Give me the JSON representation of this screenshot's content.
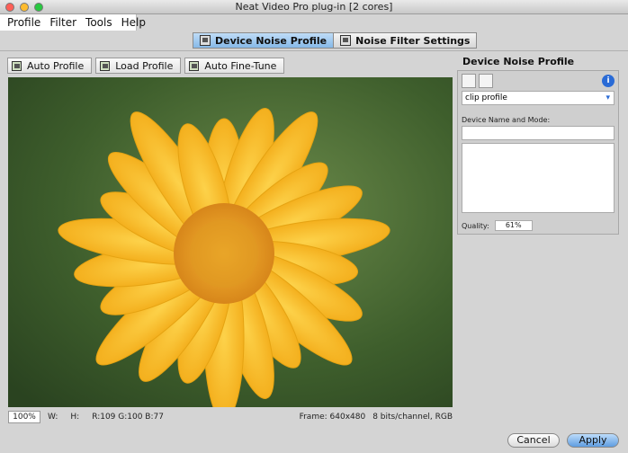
{
  "window": {
    "title": "Neat Video Pro plug-in [2 cores]"
  },
  "menu": {
    "items": [
      "Profile",
      "Filter",
      "Tools",
      "Help"
    ]
  },
  "tabs": [
    {
      "label": "Device Noise Profile",
      "active": true
    },
    {
      "label": "Noise Filter Settings",
      "active": false
    }
  ],
  "toolbar": {
    "auto_profile": "Auto Profile",
    "load_profile": "Load Profile",
    "auto_fine_tune": "Auto Fine-Tune"
  },
  "status": {
    "zoom": "100%",
    "w": "W:",
    "h": "H:",
    "rgb": "R:109 G:100 B:77",
    "frame": "Frame: 640x480",
    "bits": "8 bits/channel, RGB"
  },
  "side_panel": {
    "title": "Device Noise Profile",
    "dropdown_value": "clip profile",
    "device_label": "Device Name and Mode:",
    "quality_label": "Quality:",
    "quality_value": "61%"
  },
  "buttons": {
    "cancel": "Cancel",
    "apply": "Apply"
  },
  "colors": {
    "accent": "#2a6bd6",
    "active_tab": "#86b9e8"
  }
}
